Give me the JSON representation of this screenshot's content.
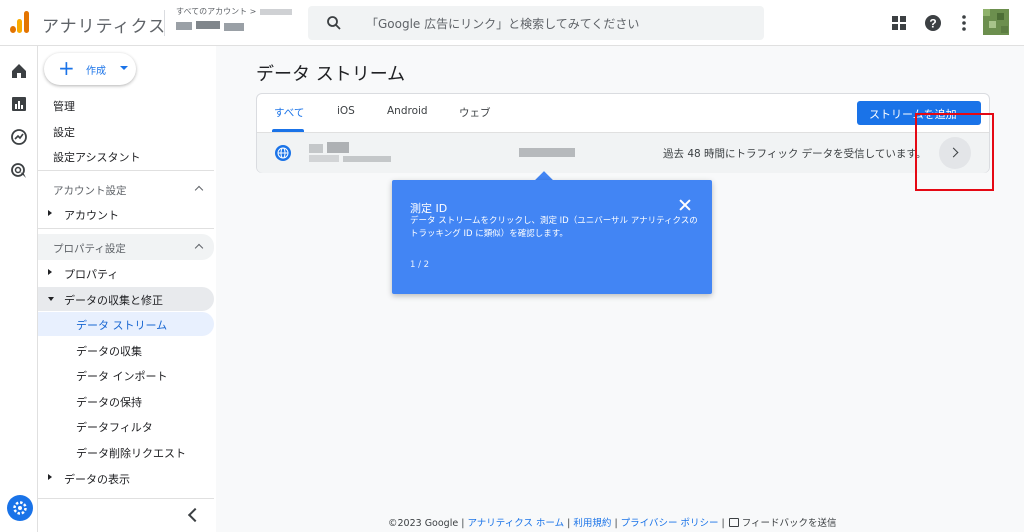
{
  "header": {
    "app_title": "アナリティクス",
    "breadcrumb": "すべてのアカウント >",
    "search_placeholder": "「Google 広告にリンク」と検索してみてください"
  },
  "nav": {
    "create_label": "作成",
    "top_items": [
      "管理",
      "設定",
      "設定アシスタント"
    ],
    "account_section": "アカウント設定",
    "account_item": "アカウント",
    "property_section": "プロパティ設定",
    "property_item": "プロパティ",
    "data_collection": "データの収集と修正",
    "sub_items": [
      "データ ストリーム",
      "データの収集",
      "データ インポート",
      "データの保持",
      "データフィルタ",
      "データ削除リクエスト"
    ],
    "data_display": "データの表示"
  },
  "main": {
    "page_title": "データ ストリーム",
    "tabs": [
      "すべて",
      "iOS",
      "Android",
      "ウェブ"
    ],
    "add_stream_label": "ストリームを追加",
    "stream_status": "過去 48 時間にトラフィック データを受信しています。"
  },
  "popover": {
    "title": "測定 ID",
    "body": "データ ストリームをクリックし、測定 ID（ユニバーサル アナリティクスのトラッキング ID に類似）を確認します。",
    "step": "1 / 2"
  },
  "footer": {
    "copyright": "©2023 Google |",
    "link_home": "アナリティクス ホーム",
    "link_terms": "利用規約",
    "link_privacy": "プライバシー ポリシー",
    "feedback": "フィードバックを送信"
  },
  "colors": {
    "accent": "#1a73e8",
    "popover": "#4285f4",
    "highlight": "#e50914"
  }
}
